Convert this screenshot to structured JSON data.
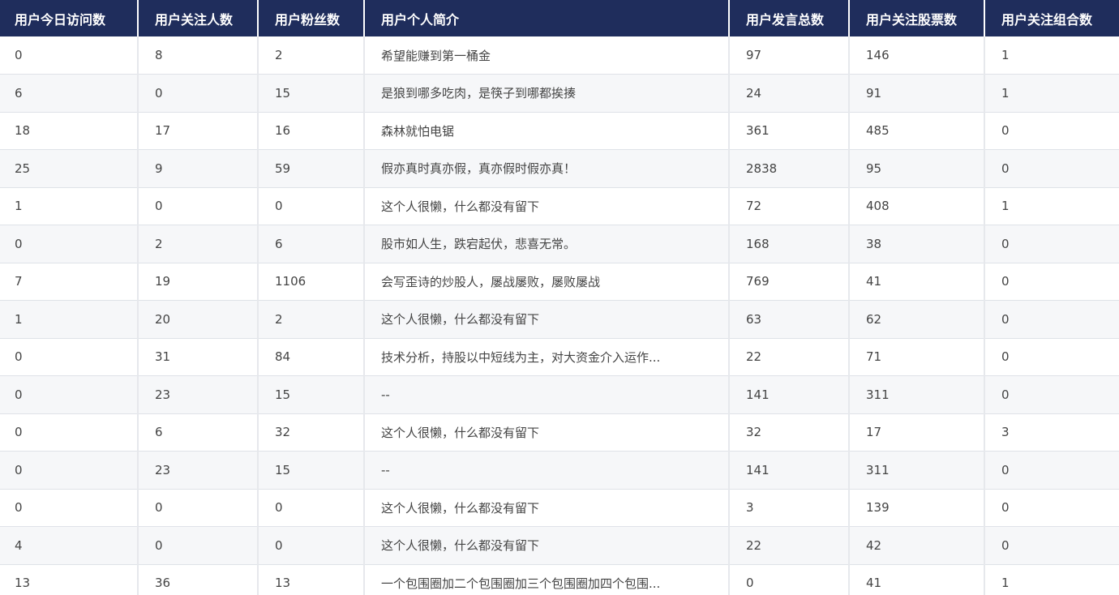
{
  "table": {
    "headers": [
      "用户今日访问数",
      "用户关注人数",
      "用户粉丝数",
      "用户个人简介",
      "用户发言总数",
      "用户关注股票数",
      "用户关注组合数"
    ],
    "rows": [
      [
        "0",
        "8",
        "2",
        "希望能赚到第一桶金",
        "97",
        "146",
        "1"
      ],
      [
        "6",
        "0",
        "15",
        "是狼到哪多吃肉，是筷子到哪都挨揍",
        "24",
        "91",
        "1"
      ],
      [
        "18",
        "17",
        "16",
        "森林就怕电锯",
        "361",
        "485",
        "0"
      ],
      [
        "25",
        "9",
        "59",
        "假亦真时真亦假，真亦假时假亦真！",
        "2838",
        "95",
        "0"
      ],
      [
        "1",
        "0",
        "0",
        "这个人很懒，什么都没有留下",
        "72",
        "408",
        "1"
      ],
      [
        "0",
        "2",
        "6",
        "股市如人生，跌宕起伏，悲喜无常。",
        "168",
        "38",
        "0"
      ],
      [
        "7",
        "19",
        "1106",
        "会写歪诗的炒股人，屡战屡败，屡败屡战",
        "769",
        "41",
        "0"
      ],
      [
        "1",
        "20",
        "2",
        "这个人很懒，什么都没有留下",
        "63",
        "62",
        "0"
      ],
      [
        "0",
        "31",
        "84",
        "技术分析，持股以中短线为主，对大资金介入运作...",
        "22",
        "71",
        "0"
      ],
      [
        "0",
        "23",
        "15",
        "--",
        "141",
        "311",
        "0"
      ],
      [
        "0",
        "6",
        "32",
        "这个人很懒，什么都没有留下",
        "32",
        "17",
        "3"
      ],
      [
        "0",
        "23",
        "15",
        "--",
        "141",
        "311",
        "0"
      ],
      [
        "0",
        "0",
        "0",
        "这个人很懒，什么都没有留下",
        "3",
        "139",
        "0"
      ],
      [
        "4",
        "0",
        "0",
        "这个人很懒，什么都没有留下",
        "22",
        "42",
        "0"
      ],
      [
        "13",
        "36",
        "13",
        "一个包围圈加二个包围圈加三个包围圈加四个包围...",
        "0",
        "41",
        "1"
      ]
    ]
  }
}
